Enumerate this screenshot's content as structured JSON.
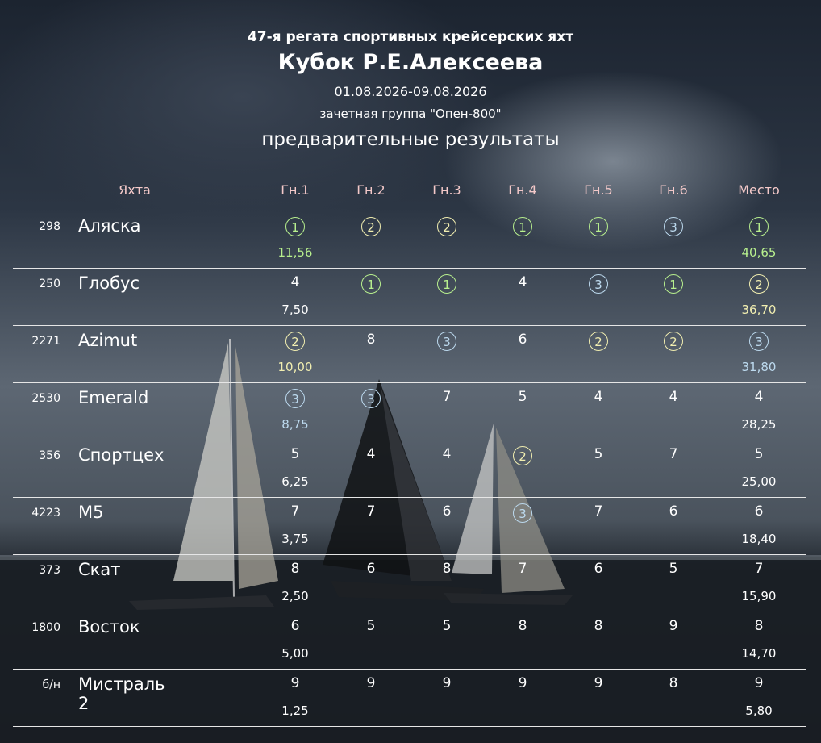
{
  "header": {
    "line1": "47-я регата спортивных крейсерских яхт",
    "title": "Кубок Р.Е.Алексеева",
    "dates": "01.08.2026-09.08.2026",
    "group": "зачетная группа \"Опен-800\"",
    "subtitle": "предварительные результаты"
  },
  "colors": {
    "first": "#b8f08e",
    "second": "#f1eeb0",
    "third": "#bcd9ee",
    "header_text": "#f4c9c9",
    "plain": "#ffffff"
  },
  "columns": [
    "Яхта",
    "Гн.1",
    "Гн.2",
    "Гн.3",
    "Гн.4",
    "Гн.5",
    "Гн.6",
    "Место"
  ],
  "rows": [
    {
      "num": "298",
      "name": "Аляска",
      "races": [
        "1",
        "2",
        "2",
        "1",
        "1",
        "3"
      ],
      "place": "1",
      "r1_points": "11,56",
      "total": "40,65"
    },
    {
      "num": "250",
      "name": "Глобус",
      "races": [
        "4",
        "1",
        "1",
        "4",
        "3",
        "1"
      ],
      "place": "2",
      "r1_points": "7,50",
      "total": "36,70"
    },
    {
      "num": "2271",
      "name": "Azimut",
      "races": [
        "2",
        "8",
        "3",
        "6",
        "2",
        "2"
      ],
      "place": "3",
      "r1_points": "10,00",
      "total": "31,80"
    },
    {
      "num": "2530",
      "name": "Emerald",
      "races": [
        "3",
        "3",
        "7",
        "5",
        "4",
        "4"
      ],
      "place": "4",
      "r1_points": "8,75",
      "total": "28,25"
    },
    {
      "num": "356",
      "name": "Спортцех",
      "races": [
        "5",
        "4",
        "4",
        "2",
        "5",
        "7"
      ],
      "place": "5",
      "r1_points": "6,25",
      "total": "25,00"
    },
    {
      "num": "4223",
      "name": "M5",
      "races": [
        "7",
        "7",
        "6",
        "3",
        "7",
        "6"
      ],
      "place": "6",
      "r1_points": "3,75",
      "total": "18,40"
    },
    {
      "num": "373",
      "name": "Скат",
      "races": [
        "8",
        "6",
        "8",
        "7",
        "6",
        "5"
      ],
      "place": "7",
      "r1_points": "2,50",
      "total": "15,90"
    },
    {
      "num": "1800",
      "name": "Восток",
      "races": [
        "6",
        "5",
        "5",
        "8",
        "8",
        "9"
      ],
      "place": "8",
      "r1_points": "5,00",
      "total": "14,70"
    },
    {
      "num": "б/н",
      "name": "Мистраль 2",
      "races": [
        "9",
        "9",
        "9",
        "9",
        "9",
        "8"
      ],
      "place": "9",
      "r1_points": "1,25",
      "total": "5,80"
    }
  ]
}
